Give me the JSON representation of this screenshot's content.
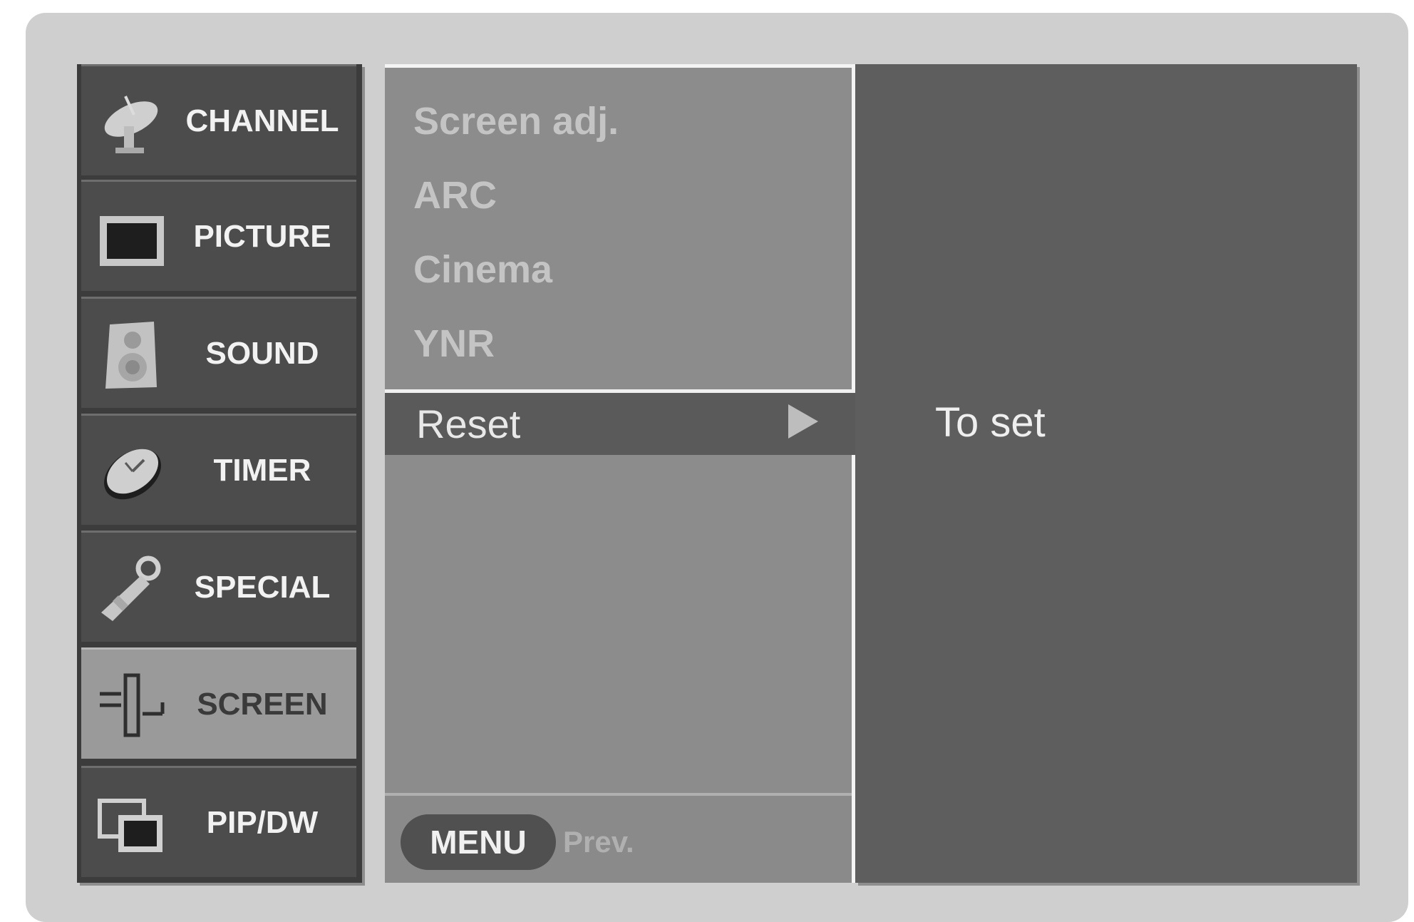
{
  "sidebar": {
    "items": [
      {
        "label": "CHANNEL",
        "icon": "satellite-dish-icon"
      },
      {
        "label": "PICTURE",
        "icon": "tv-screen-icon"
      },
      {
        "label": "SOUND",
        "icon": "speaker-icon"
      },
      {
        "label": "TIMER",
        "icon": "clock-icon"
      },
      {
        "label": "SPECIAL",
        "icon": "key-icon"
      },
      {
        "label": "SCREEN",
        "icon": "screen-adjust-icon",
        "active": true
      },
      {
        "label": "PIP/DW",
        "icon": "pip-window-icon"
      }
    ]
  },
  "submenu": {
    "items": [
      "Screen adj.",
      "ARC",
      "Cinema",
      "YNR"
    ],
    "selected": "Reset"
  },
  "footer": {
    "menu_button": "MENU",
    "prev_label": "Prev."
  },
  "info": {
    "text": "To set"
  }
}
